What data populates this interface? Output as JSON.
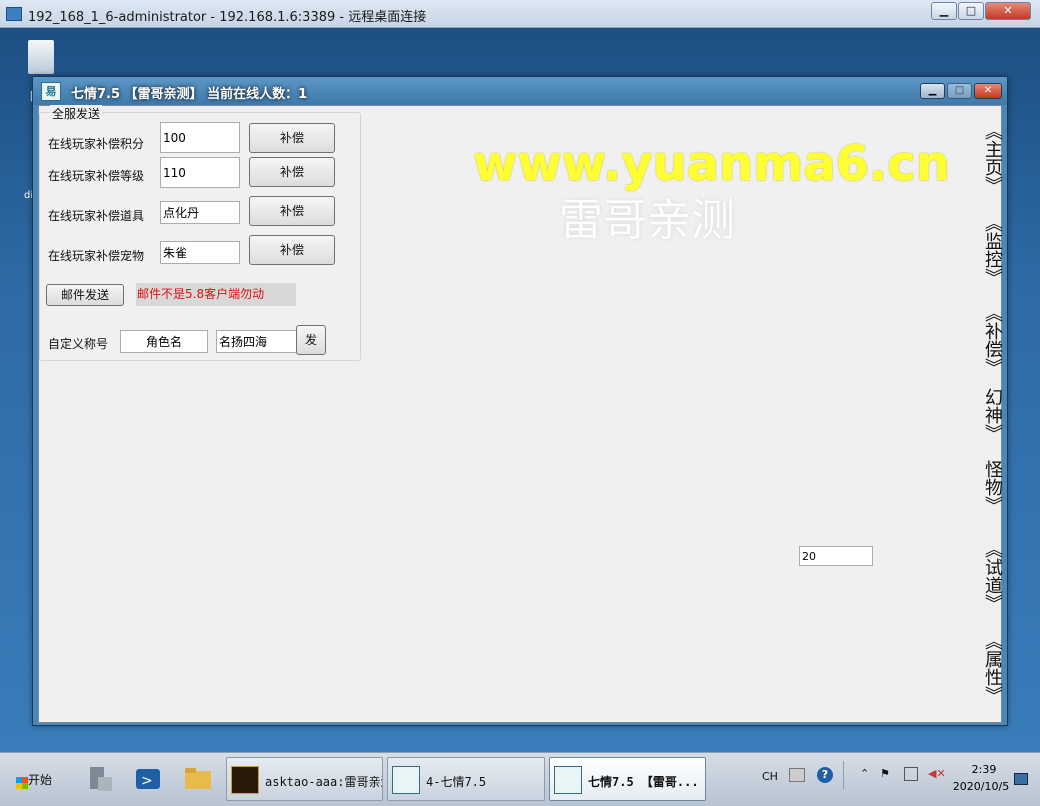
{
  "rdp": {
    "title": "192_168_1_6-administrator - 192.168.1.6:3389 - 远程桌面连接",
    "min_label": "▁",
    "max_label": "□",
    "close_label": "✕"
  },
  "desktop": {
    "label_1": "回",
    "label_2": "dis"
  },
  "app": {
    "icon_label": "易",
    "title": "七情7.5 【雷哥亲测】 当前在线人数：1",
    "min_label": "▁",
    "max_label": "□",
    "close_label": "✕"
  },
  "group": {
    "title": "全服发送",
    "rows": [
      {
        "label": "在线玩家补偿积分",
        "value": "100",
        "button": "补偿"
      },
      {
        "label": "在线玩家补偿等级",
        "value": "110",
        "button": "补偿"
      },
      {
        "label": "在线玩家补偿道具",
        "value": "点化丹",
        "button": "补偿"
      },
      {
        "label": "在线玩家补偿宠物",
        "value": "朱雀",
        "button": "补偿"
      }
    ],
    "mail_button": "邮件发送",
    "mail_warning": "邮件不是5.8客户端勿动",
    "custom_title_label": "自定义称号",
    "role_name_value": "角色名",
    "title_value": "名扬四海",
    "send_button": "发"
  },
  "watermark": {
    "url": "www.yuanma6.cn",
    "text": "雷哥亲测"
  },
  "floating_input_value": "20",
  "nav": {
    "items": [
      "《主页》",
      "《监控》",
      "《补偿》",
      "幻神》",
      "怪物》",
      "《试道》",
      "《属性》"
    ]
  },
  "taskbar": {
    "start_label": "开始",
    "tasks": [
      {
        "label": "asktao-aaa:雷哥亲测"
      },
      {
        "label": "4-七情7.5"
      },
      {
        "label": "七情7.5 【雷哥..."
      }
    ],
    "lang": "CH",
    "time": "2:39",
    "date": "2020/10/5"
  }
}
